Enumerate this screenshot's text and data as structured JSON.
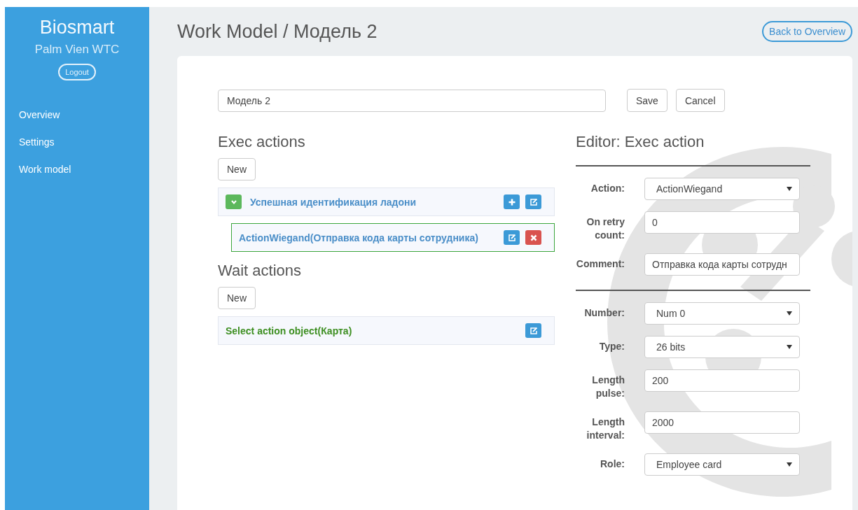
{
  "sidebar": {
    "brand": "Biosmart",
    "subtitle": "Palm Vien WTC",
    "logout": "Logout",
    "items": [
      {
        "label": "Overview",
        "selected": false
      },
      {
        "label": "Settings",
        "selected": false
      },
      {
        "label": "Work model",
        "selected": false
      }
    ]
  },
  "header": {
    "title": "Work Model / Модель 2",
    "back_button": "Back to Overview"
  },
  "name_field": {
    "value": "Модель 2"
  },
  "buttons": [
    "Save",
    "Cancel"
  ],
  "exec_actions": {
    "title": "Exec actions",
    "new_button": "New",
    "items": [
      {
        "label": "Успешная идентификация ладони",
        "expanded": true,
        "tools": [
          {
            "kind": "add"
          },
          {
            "kind": "edit"
          }
        ],
        "children": [
          {
            "label": "ActionWiegand(Отправка кода карты сотрудника)",
            "selected": true,
            "tools": [
              {
                "kind": "edit"
              },
              {
                "kind": "delete"
              }
            ]
          }
        ]
      }
    ]
  },
  "wait_actions": {
    "title": "Wait actions",
    "new_button": "New",
    "items": [
      {
        "label": "Select action object(Карта)",
        "tools": [
          {
            "kind": "edit"
          }
        ]
      }
    ]
  },
  "editor": {
    "title": "Editor: Exec action",
    "sections": [
      {
        "fields": [
          {
            "label": "Action:",
            "kind": "select",
            "value": "ActionWiegand"
          },
          {
            "label": "On retry count:",
            "kind": "input",
            "value": "0"
          },
          {
            "label": "Comment:",
            "kind": "input",
            "value": "Отправка кода карты сотрудн"
          }
        ]
      },
      {
        "fields": [
          {
            "label": "Number:",
            "kind": "select",
            "value": "Num 0"
          },
          {
            "label": "Type:",
            "kind": "select",
            "value": "26 bits"
          },
          {
            "label": "Length pulse:",
            "kind": "input",
            "value": "200"
          },
          {
            "label": "Length interval:",
            "kind": "input",
            "value": "2000"
          },
          {
            "label": "Role:",
            "kind": "select",
            "value": "Employee card"
          }
        ]
      }
    ]
  }
}
